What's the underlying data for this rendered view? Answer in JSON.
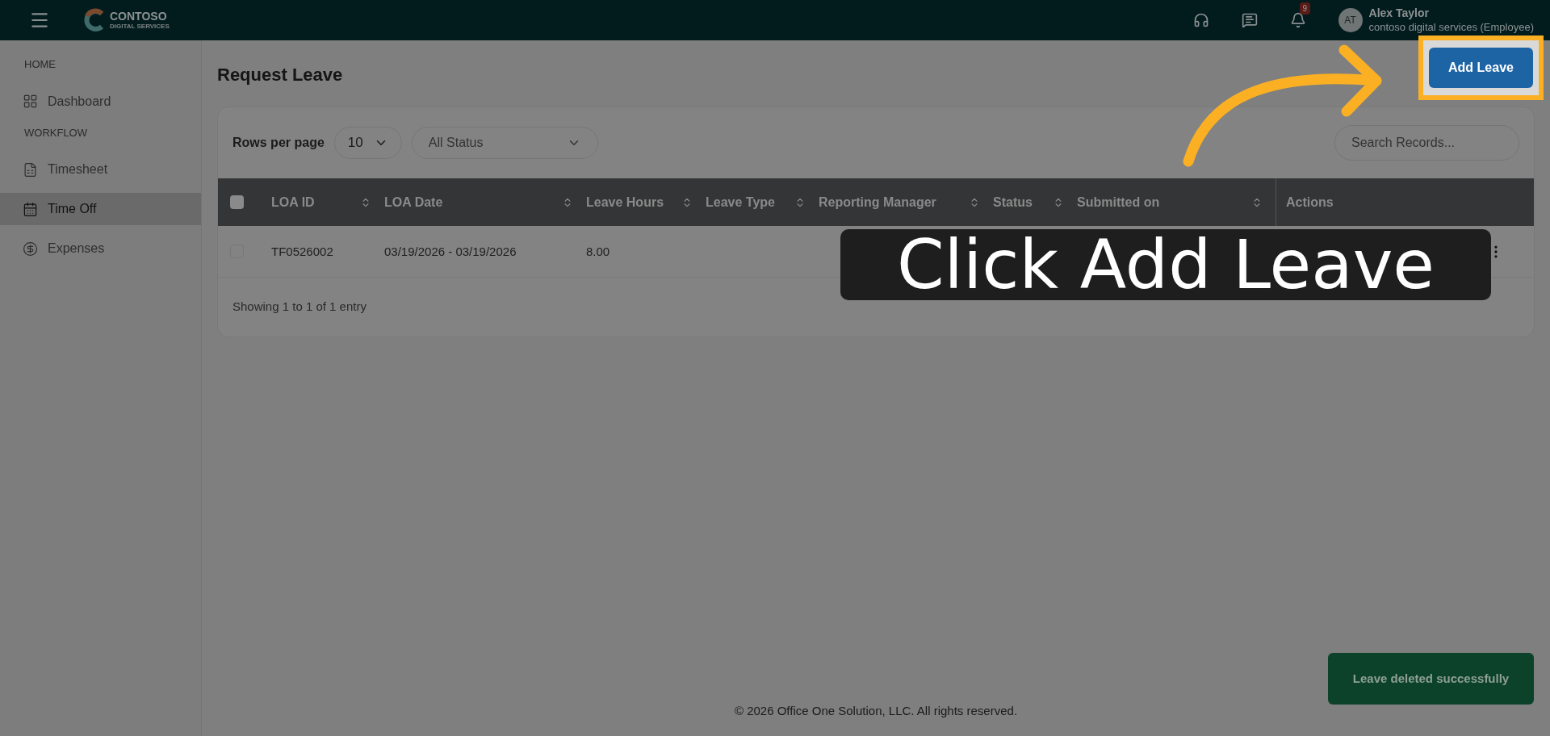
{
  "topbar": {
    "logo": {
      "name": "CONTOSO",
      "tagline": "DIGITAL SERVICES"
    },
    "notifications": "9",
    "user": {
      "initials": "AT",
      "name": "Alex Taylor",
      "org": "contoso digital services (Employee)"
    }
  },
  "sidebar": {
    "sections": [
      {
        "heading": "HOME",
        "items": [
          {
            "label": "Dashboard",
            "selected": false
          }
        ]
      },
      {
        "heading": "WORKFLOW",
        "items": [
          {
            "label": "Timesheet",
            "selected": false
          },
          {
            "label": "Time Off",
            "selected": true
          },
          {
            "label": "Expenses",
            "selected": false
          }
        ]
      }
    ]
  },
  "page": {
    "title": "Request Leave",
    "add_button": "Add Leave"
  },
  "controls": {
    "rows_label": "Rows per page",
    "rows_value": "10",
    "status_value": "All Status",
    "search_placeholder": "Search Records..."
  },
  "table": {
    "all_checked": false,
    "columns": [
      {
        "label": "LOA ID",
        "sortable": true
      },
      {
        "label": "LOA Date",
        "sortable": true
      },
      {
        "label": "Leave Hours",
        "sortable": true
      },
      {
        "label": "Leave Type",
        "sortable": true
      },
      {
        "label": "Reporting Manager",
        "sortable": true
      },
      {
        "label": "Status",
        "sortable": true
      },
      {
        "label": "Submitted on",
        "sortable": true
      },
      {
        "label": "Actions",
        "sortable": false
      }
    ],
    "rows": [
      {
        "checked": false,
        "cells": [
          "TF0526002",
          "03/19/2026 - 03/19/2026",
          "8.00"
        ]
      }
    ],
    "summary": "Showing 1 to 1 of 1 entry"
  },
  "callout": "Click Add Leave",
  "toast": "Leave deleted successfully",
  "footer": "© 2026 Office One Solution, LLC. All rights reserved."
}
